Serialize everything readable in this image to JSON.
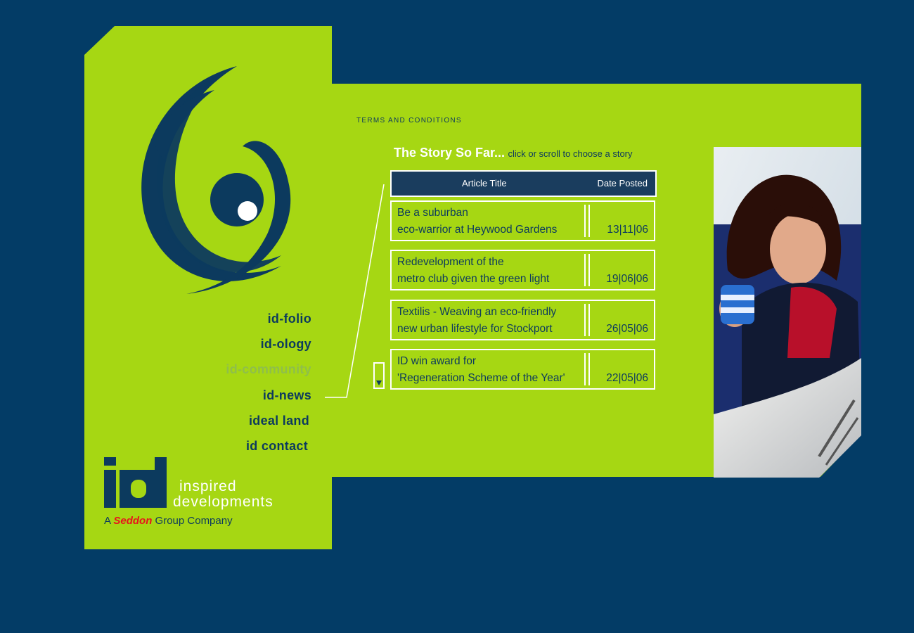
{
  "colors": {
    "background": "#033c66",
    "panel_green": "#a6d713",
    "navy": "#0c3a5e",
    "accent_red": "#e8141c"
  },
  "header": {
    "terms_link": "TERMS AND CONDITIONS"
  },
  "stories": {
    "title": "The Story So Far...",
    "subtitle": "click or scroll to choose a story",
    "columns": {
      "title": "Article Title",
      "date": "Date Posted"
    },
    "articles": [
      {
        "line1": "Be a suburban",
        "line2": "eco-warrior at Heywood Gardens",
        "date": "13|11|06"
      },
      {
        "line1": "Redevelopment of the",
        "line2": "metro club given the green light",
        "date": "19|06|06"
      },
      {
        "line1": "Textilis - Weaving an eco-friendly",
        "line2": "new urban lifestyle for Stockport",
        "date": "26|05|06"
      },
      {
        "line1": "ID win award for",
        "line2": "'Regeneration Scheme of the Year'",
        "date": "22|05|06"
      }
    ],
    "scroll_icon": "down-arrow-icon"
  },
  "nav": {
    "items": [
      {
        "label": "id-folio"
      },
      {
        "label": "id-ology"
      },
      {
        "label": "id-community"
      },
      {
        "label": "id-news"
      },
      {
        "label": "ideal land"
      },
      {
        "label": "id contact"
      }
    ],
    "active_index": 3,
    "dimmed_index": 2
  },
  "brand": {
    "logo_letters": "id",
    "name_line1": "inspired",
    "name_line2": "developments",
    "tagline_prefix": "A",
    "tagline_company": "Seddon",
    "tagline_suffix": "Group Company"
  },
  "photo": {
    "subject": "woman-reading-newspaper-with-mug"
  }
}
